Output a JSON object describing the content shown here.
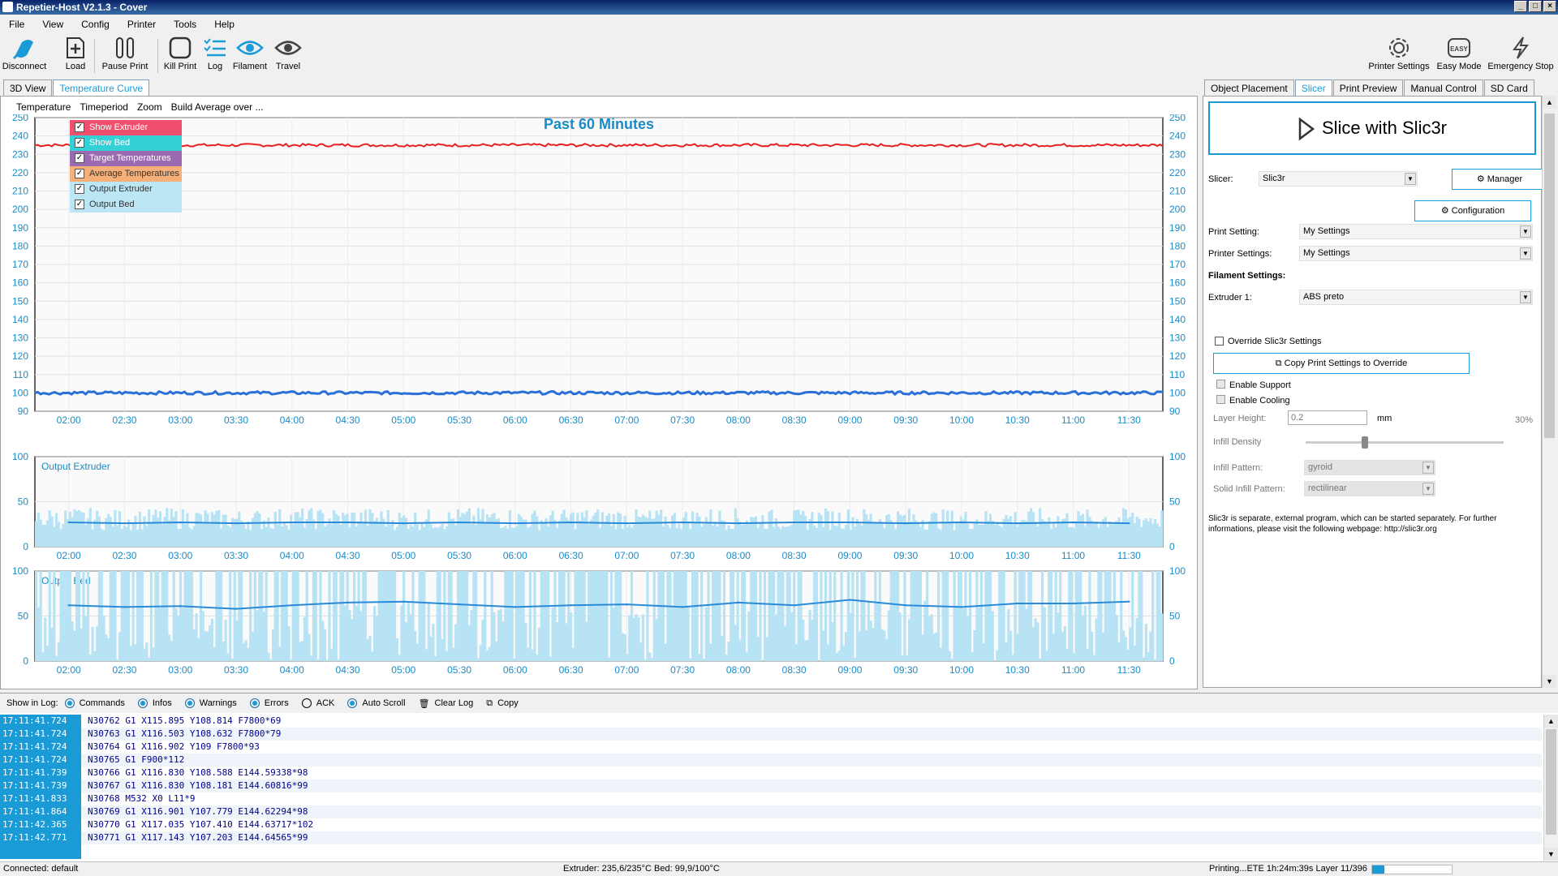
{
  "window": {
    "title": "Repetier-Host V2.1.3 - Cover"
  },
  "menu": [
    "File",
    "View",
    "Config",
    "Printer",
    "Tools",
    "Help"
  ],
  "toolbar": {
    "left": [
      {
        "label": "Disconnect",
        "icon": "disconnect-icon"
      },
      {
        "label": "Load",
        "icon": "load-icon"
      },
      {
        "label": "Pause Print",
        "icon": "pause-icon"
      },
      {
        "label": "Kill Print",
        "icon": "kill-icon"
      },
      {
        "label": "Log",
        "icon": "log-icon"
      },
      {
        "label": "Filament",
        "icon": "filament-eye-icon"
      },
      {
        "label": "Travel",
        "icon": "travel-eye-icon"
      }
    ],
    "right": [
      {
        "label": "Printer Settings",
        "icon": "gear-icon"
      },
      {
        "label": "Easy Mode",
        "icon": "easy-icon",
        "badge": "EASY"
      },
      {
        "label": "Emergency Stop",
        "icon": "lightning-icon"
      }
    ]
  },
  "left_tabs": [
    "3D View",
    "Temperature Curve"
  ],
  "chart_menu": [
    "Temperature",
    "Timeperiod",
    "Zoom",
    "Build Average over ..."
  ],
  "legend": [
    {
      "label": "Show Extruder",
      "color": "#f0506e"
    },
    {
      "label": "Show Bed",
      "color": "#33d0d8"
    },
    {
      "label": "Target Temperatures",
      "color": "#9b6ab0"
    },
    {
      "label": "Average Temperatures",
      "color": "#f5b07a"
    },
    {
      "label": "Output Extruder",
      "color": "#bde6f5"
    },
    {
      "label": "Output Bed",
      "color": "#bde6f5"
    }
  ],
  "chart_data": [
    {
      "type": "line",
      "title": "Past 60 Minutes",
      "ylim": [
        90,
        250
      ],
      "yticks": [
        250,
        240,
        230,
        220,
        210,
        200,
        190,
        180,
        170,
        160,
        150,
        140,
        130,
        120,
        110,
        100,
        90
      ],
      "x": [
        "02:00",
        "02:30",
        "03:00",
        "03:30",
        "04:00",
        "04:30",
        "05:00",
        "05:30",
        "06:00",
        "06:30",
        "07:00",
        "07:30",
        "08:00",
        "08:30",
        "09:00",
        "09:30",
        "10:00",
        "10:30",
        "11:00",
        "11:30"
      ],
      "series": [
        {
          "name": "Show Extruder",
          "values": [
            235,
            235,
            235,
            235,
            235,
            235,
            235,
            235,
            235,
            235,
            235,
            235,
            235,
            235,
            235,
            235,
            235,
            235,
            235,
            235
          ],
          "color": "#e82020"
        },
        {
          "name": "Show Bed",
          "values": [
            100,
            100,
            100,
            100,
            100,
            100,
            100,
            100,
            100,
            100,
            100,
            100,
            100,
            100,
            100,
            100,
            100,
            100,
            100,
            100
          ],
          "color": "#2a70d8"
        }
      ]
    },
    {
      "type": "area",
      "title": "Output Extruder",
      "ylim": [
        0,
        100
      ],
      "yticks": [
        100,
        50,
        0
      ],
      "x": [
        "02:00",
        "02:30",
        "03:00",
        "03:30",
        "04:00",
        "04:30",
        "05:00",
        "05:30",
        "06:00",
        "06:30",
        "07:00",
        "07:30",
        "08:00",
        "08:30",
        "09:00",
        "09:30",
        "10:00",
        "10:30",
        "11:00",
        "11:30"
      ],
      "series": [
        {
          "name": "Output Extruder",
          "values": [
            27,
            26,
            27,
            26,
            27,
            27,
            26,
            27,
            26,
            27,
            26,
            27,
            26,
            27,
            27,
            26,
            27,
            26,
            27,
            26
          ]
        }
      ]
    },
    {
      "type": "area",
      "title": "Output Bed",
      "ylim": [
        0,
        100
      ],
      "yticks": [
        100,
        50,
        0
      ],
      "x": [
        "02:00",
        "02:30",
        "03:00",
        "03:30",
        "04:00",
        "04:30",
        "05:00",
        "05:30",
        "06:00",
        "06:30",
        "07:00",
        "07:30",
        "08:00",
        "08:30",
        "09:00",
        "09:30",
        "10:00",
        "10:30",
        "11:00",
        "11:30"
      ],
      "series": [
        {
          "name": "Output Bed",
          "values": [
            62,
            60,
            61,
            58,
            62,
            65,
            66,
            63,
            60,
            62,
            63,
            60,
            65,
            62,
            68,
            62,
            60,
            64,
            64,
            66
          ]
        }
      ]
    }
  ],
  "right_tabs": [
    "Object Placement",
    "Slicer",
    "Print Preview",
    "Manual Control",
    "SD Card"
  ],
  "slicer": {
    "slice_button": "Slice with Slic3r",
    "slicer_label": "Slicer:",
    "slicer_value": "Slic3r",
    "manager": "Manager",
    "configuration": "Configuration",
    "print_setting_label": "Print Setting:",
    "print_setting_value": "My Settings",
    "printer_settings_label": "Printer Settings:",
    "printer_settings_value": "My Settings",
    "filament_heading": "Filament Settings:",
    "extruder1_label": "Extruder 1:",
    "extruder1_value": "ABS preto",
    "override_label": "Override Slic3r Settings",
    "copy_button": "Copy Print Settings to Override",
    "enable_support": "Enable Support",
    "enable_cooling": "Enable Cooling",
    "layer_height_label": "Layer Height:",
    "layer_height_value": "0.2",
    "layer_height_unit": "mm",
    "infill_percent": "30%",
    "infill_density_label": "Infill Density",
    "infill_density": 0.3,
    "infill_pattern_label": "Infill Pattern:",
    "infill_pattern_value": "gyroid",
    "solid_infill_label": "Solid Infill Pattern:",
    "solid_infill_value": "rectilinear",
    "info": "Slic3r is separate, external program, which can be started separately. For further informations, please visit the following webpage: http://slic3r.org"
  },
  "log": {
    "show_label": "Show in Log:",
    "filters": [
      {
        "label": "Commands",
        "on": true
      },
      {
        "label": "Infos",
        "on": true
      },
      {
        "label": "Warnings",
        "on": true
      },
      {
        "label": "Errors",
        "on": true
      },
      {
        "label": "ACK",
        "on": false
      },
      {
        "label": "Auto Scroll",
        "on": true
      }
    ],
    "clear": "Clear Log",
    "copy": "Copy",
    "rows": [
      {
        "time": "17:11:41.724",
        "msg": "N30762 G1 X115.895 Y108.814 F7800*69"
      },
      {
        "time": "17:11:41.724",
        "msg": "N30763 G1 X116.503 Y108.632 F7800*79"
      },
      {
        "time": "17:11:41.724",
        "msg": "N30764 G1 X116.902 Y109 F7800*93"
      },
      {
        "time": "17:11:41.724",
        "msg": "N30765 G1 F900*112"
      },
      {
        "time": "17:11:41.739",
        "msg": "N30766 G1 X116.830 Y108.588 E144.59338*98"
      },
      {
        "time": "17:11:41.739",
        "msg": "N30767 G1 X116.830 Y108.181 E144.60816*99"
      },
      {
        "time": "17:11:41.833",
        "msg": "N30768 M532 X0 L11*9"
      },
      {
        "time": "17:11:41.864",
        "msg": "N30769 G1 X116.901 Y107.779 E144.62294*98"
      },
      {
        "time": "17:11:42.365",
        "msg": "N30770 G1 X117.035 Y107.410 E144.63717*102"
      },
      {
        "time": "17:11:42.771",
        "msg": "N30771 G1 X117.143 Y107.203 E144.64565*99"
      }
    ]
  },
  "status": {
    "connected": "Connected: default",
    "temps": "Extruder: 235,6/235°C Bed: 99,9/100°C",
    "printing": "Printing...ETE 1h:24m:39s Layer 11/396",
    "progress": 0.15
  }
}
